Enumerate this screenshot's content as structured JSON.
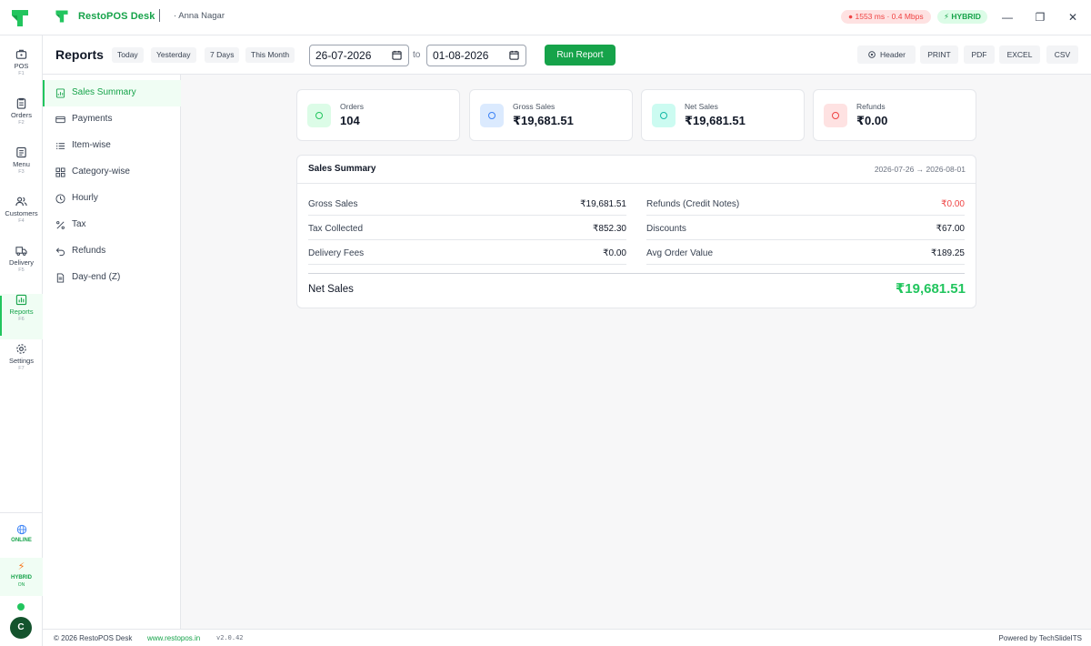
{
  "titlebar": {
    "app_name": "RestoPOS Desk",
    "branch": "· Anna Nagar",
    "network": "1553 ms · 0.4 Mbps",
    "mode": "HYBRID"
  },
  "rail": {
    "items": [
      {
        "label": "POS",
        "key": "F1",
        "icon": "pos-icon"
      },
      {
        "label": "Orders",
        "key": "F2",
        "icon": "orders-icon"
      },
      {
        "label": "Menu",
        "key": "F3",
        "icon": "menu-icon"
      },
      {
        "label": "Customers",
        "key": "F4",
        "icon": "customers-icon"
      },
      {
        "label": "Delivery",
        "key": "F5",
        "icon": "delivery-icon"
      },
      {
        "label": "Reports",
        "key": "F6",
        "icon": "reports-icon"
      },
      {
        "label": "Settings",
        "key": "F7",
        "icon": "gear-icon"
      }
    ],
    "active": "Reports",
    "online": "ONLINE",
    "hybrid": "HYBRID",
    "hybrid_state": "ON",
    "avatar": "C"
  },
  "toolbar": {
    "title": "Reports",
    "ranges": [
      "Today",
      "Yesterday",
      "7 Days",
      "This Month"
    ],
    "from_date": "26-07-2026",
    "to_label": "to",
    "to_date": "01-08-2026",
    "run": "Run Report",
    "header": "Header",
    "print": "PRINT",
    "pdf": "PDF",
    "excel": "EXCEL",
    "csv": "CSV"
  },
  "report_nav": {
    "items": [
      "Sales Summary",
      "Payments",
      "Item-wise",
      "Category-wise",
      "Hourly",
      "Tax",
      "Refunds",
      "Day-end (Z)"
    ],
    "active": "Sales Summary"
  },
  "stats": [
    {
      "label": "Orders",
      "value": "104",
      "color": "#22c55e"
    },
    {
      "label": "Gross Sales",
      "value": "₹19,681.51",
      "color": "#3b82f6"
    },
    {
      "label": "Net Sales",
      "value": "₹19,681.51",
      "color": "#14b8a6"
    },
    {
      "label": "Refunds",
      "value": "₹0.00",
      "color": "#ef4444"
    }
  ],
  "summary": {
    "title": "Sales Summary",
    "range": "2026-07-26 → 2026-08-01",
    "left": [
      {
        "label": "Gross Sales",
        "value": "₹19,681.51"
      },
      {
        "label": "Tax Collected",
        "value": "₹852.30"
      },
      {
        "label": "Delivery Fees",
        "value": "₹0.00"
      }
    ],
    "right": [
      {
        "label": "Refunds (Credit Notes)",
        "value": "₹0.00"
      },
      {
        "label": "Discounts",
        "value": "₹67.00"
      },
      {
        "label": "Avg Order Value",
        "value": "₹189.25"
      }
    ],
    "net_label": "Net Sales",
    "net_value": "₹19,681.51"
  },
  "footer": {
    "copyright": "© 2026 RestoPOS Desk",
    "link": "www.restopos.in",
    "version": "v2.0.42",
    "powered": "Powered by TechSlideITS"
  }
}
